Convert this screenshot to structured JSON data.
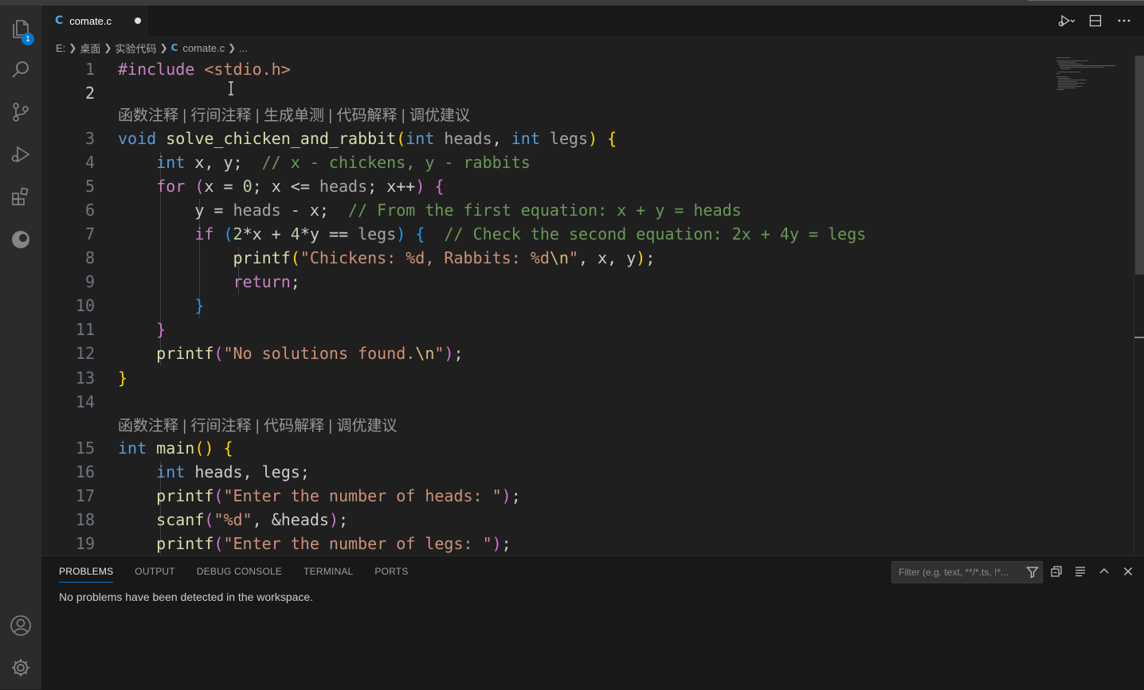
{
  "tab": {
    "icon_letter": "C",
    "file_name": "comate.c"
  },
  "activity": {
    "explorer_badge": "1"
  },
  "breadcrumb": {
    "drive": "E:",
    "folder1": "桌面",
    "folder2": "实验代码",
    "file_icon": "C",
    "file": "comate.c",
    "more": "..."
  },
  "codelens": {
    "first": "函数注释 | 行间注释 | 生成单测 | 代码解释 | 调优建议",
    "second": "函数注释 | 行间注释 | 代码解释 | 调优建议"
  },
  "line_numbers": [
    "1",
    "2",
    "3",
    "4",
    "5",
    "6",
    "7",
    "8",
    "9",
    "10",
    "11",
    "12",
    "13",
    "14",
    "15",
    "16",
    "17",
    "18",
    "19"
  ],
  "code": {
    "l1": {
      "pp": "#include",
      "hdr": "<stdio.h>"
    },
    "l3": {
      "void": "void",
      "name": "solve_chicken_and_rabbit",
      "open": "(",
      "int1": "int",
      "p1": "heads",
      "comma": ", ",
      "int2": "int",
      "p2": "legs",
      "close": ")",
      "brace": "{"
    },
    "l4": {
      "int": "int",
      "vars": " x, y;",
      "cmt": "// x - chickens, y - rabbits"
    },
    "l5": {
      "for": "for",
      "open": "(",
      "a": "x = ",
      "zero": "0",
      "b": "; x <= ",
      "heads": "heads",
      "c": "; x++",
      "close": ")",
      "brace": "{"
    },
    "l6": {
      "a": "y = ",
      "heads": "heads",
      "b": " - x;",
      "cmt": "// From the first equation: x + y = heads"
    },
    "l7": {
      "if": "if",
      "open": "(",
      "n2": "2",
      "a": "*x + ",
      "n4": "4",
      "b": "*y == ",
      "legs": "legs",
      "close": ")",
      "brace": "{",
      "cmt": "// Check the second equation: 2x + 4y = legs"
    },
    "l8": {
      "fn": "printf",
      "open": "(",
      "s1": "\"Chickens: %d, Rabbits: %d",
      "esc": "\\n",
      "s2": "\"",
      "args": ", x, y",
      "close": ")",
      "semi": ";"
    },
    "l9": {
      "ret": "return",
      "semi": ";"
    },
    "l10": {
      "brace": "}"
    },
    "l11": {
      "brace": "}"
    },
    "l12": {
      "fn": "printf",
      "open": "(",
      "s1": "\"No solutions found.",
      "esc": "\\n",
      "s2": "\"",
      "close": ")",
      "semi": ";"
    },
    "l13": {
      "brace": "}"
    },
    "l15": {
      "int": "int",
      "fn": "main",
      "parens": "()",
      "brace": "{"
    },
    "l16": {
      "int": "int",
      "rest": " heads, legs;"
    },
    "l17": {
      "fn": "printf",
      "open": "(",
      "s": "\"Enter the number of heads: \"",
      "close": ")",
      "semi": ";"
    },
    "l18": {
      "fn": "scanf",
      "open": "(",
      "s": "\"%d\"",
      "rest": ", &heads",
      "close": ")",
      "semi": ";"
    },
    "l19": {
      "fn": "printf",
      "open": "(",
      "s": "\"Enter the number of legs: \"",
      "close": ")",
      "semi": ";"
    }
  },
  "panel": {
    "tabs": [
      "PROBLEMS",
      "OUTPUT",
      "DEBUG CONSOLE",
      "TERMINAL",
      "PORTS"
    ],
    "filter_placeholder": "Filter (e.g. text, **/*.ts, !*...",
    "message": "No problems have been detected in the workspace."
  },
  "colors": {
    "keyword": "#569cd6",
    "control": "#c586c0",
    "function": "#dcdcaa",
    "string": "#ce9178",
    "number": "#b5cea8",
    "comment": "#6a9955",
    "accent": "#0078d4"
  }
}
